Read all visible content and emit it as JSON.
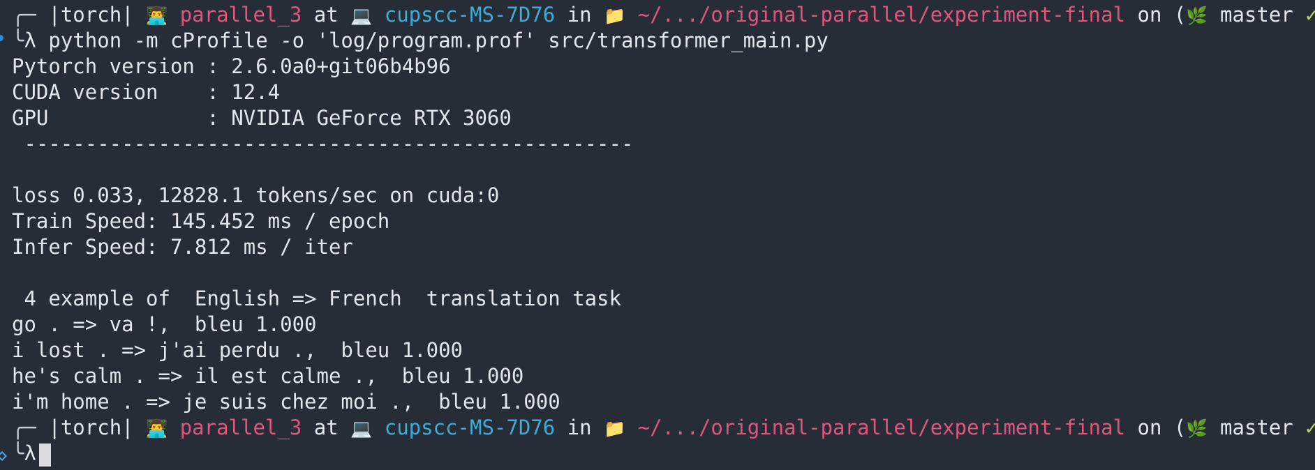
{
  "prompt": {
    "corner_top": "╭─",
    "corner_bottom": "╰",
    "env": "|torch|",
    "user_emoji": "👨‍💻",
    "user": "parallel_3",
    "at": "at",
    "host_emoji": "💻",
    "host": "cupscc-MS-7D76",
    "in": "in",
    "dir_emoji": "📁",
    "path": "~/.../original-parallel/experiment-final",
    "on": "on",
    "branch_open": "(",
    "branch_emoji": "🌿",
    "branch": "master",
    "check": "✓)",
    "lambda": "λ"
  },
  "command": "python -m cProfile -o 'log/program.prof' src/transformer_main.py",
  "output": [
    "Pytorch version : 2.6.0a0+git06b4b96",
    "CUDA version    : 12.4",
    "GPU             : NVIDIA GeForce RTX 3060",
    " --------------------------------------------------",
    "",
    "loss 0.033, 12828.1 tokens/sec on cuda:0",
    "Train Speed: 145.452 ms / epoch",
    "Infer Speed: 7.812 ms / iter",
    "",
    " 4 example of  English => French  translation task",
    "go . => va !,  bleu 1.000",
    "i lost . => j'ai perdu .,  bleu 1.000",
    "he's calm . => il est calme .,  bleu 1.000",
    "i'm home . => je suis chez moi .,  bleu 1.000"
  ],
  "colors": {
    "background": "#262d36",
    "foreground": "#e3e6ea",
    "user": "#e0567f",
    "host": "#3dacd6",
    "path": "#e0567f",
    "check": "#b9d35a"
  }
}
